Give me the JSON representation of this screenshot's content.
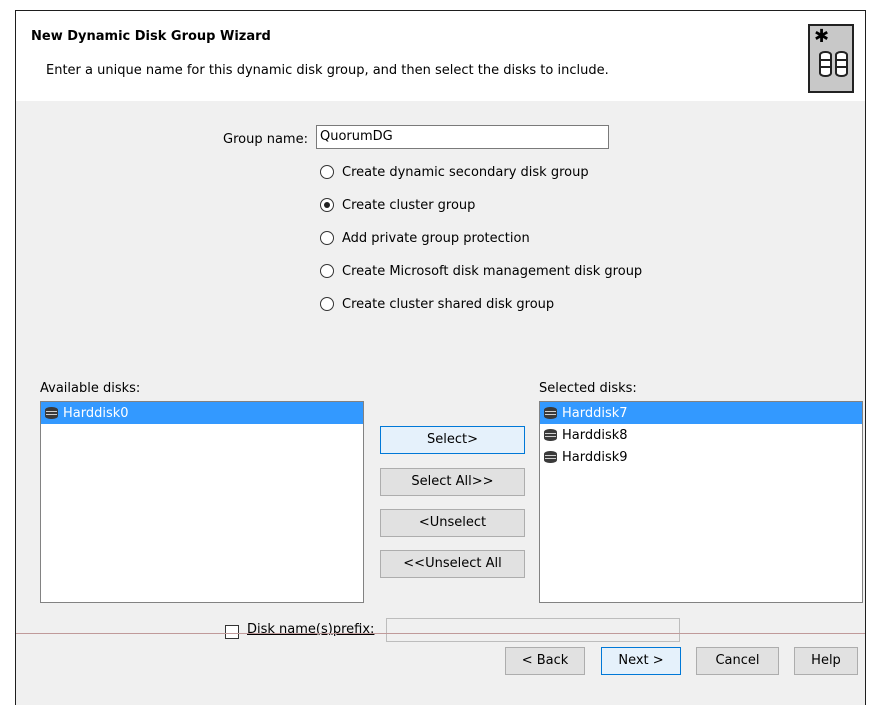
{
  "header": {
    "title": "New Dynamic Disk Group Wizard",
    "subtitle": "Enter a unique name for this dynamic disk group, and then select the disks to include.",
    "icon": "disk-group-icon"
  },
  "form": {
    "group_name_label": "Group name:",
    "group_name_value": "QuorumDG",
    "options": [
      {
        "label": "Create dynamic secondary disk group",
        "checked": false
      },
      {
        "label": "Create cluster group",
        "checked": true
      },
      {
        "label": "Add private group protection",
        "checked": false
      },
      {
        "label": "Create Microsoft disk management disk group",
        "checked": false
      },
      {
        "label": "Create cluster shared disk group",
        "checked": false
      }
    ]
  },
  "available": {
    "label": "Available disks:",
    "items": [
      "Harddisk0"
    ],
    "selected_index": 0
  },
  "selected": {
    "label": "Selected disks:",
    "items": [
      "Harddisk7",
      "Harddisk8",
      "Harddisk9"
    ],
    "selected_index": 0
  },
  "actions": {
    "select": "Select>",
    "select_all": "Select All>>",
    "unselect": "<Unselect",
    "unselect_all": "<<Unselect All"
  },
  "prefix": {
    "label": "Disk name(s)prefix:",
    "checked": false,
    "value": ""
  },
  "footer": {
    "back": "< Back",
    "next": "Next >",
    "cancel": "Cancel",
    "help": "Help"
  }
}
